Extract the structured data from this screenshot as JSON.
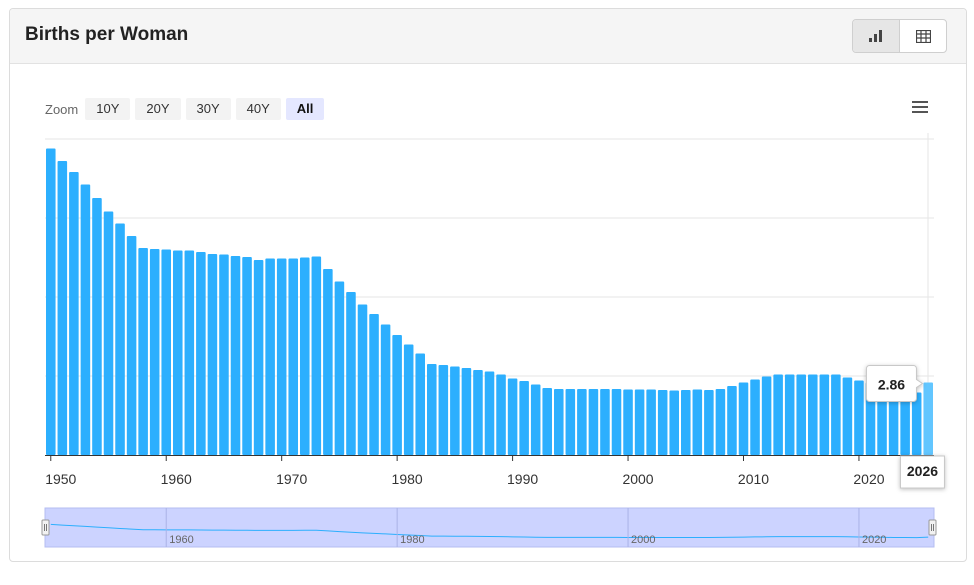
{
  "card": {
    "title": "Births per Woman",
    "toggle": [
      {
        "name": "chart-view-button",
        "icon": "bar-chart-icon",
        "active": true
      },
      {
        "name": "table-view-button",
        "icon": "table-icon",
        "active": false
      }
    ]
  },
  "zoom": {
    "label": "Zoom",
    "buttons": [
      "10Y",
      "20Y",
      "30Y",
      "40Y",
      "All"
    ],
    "active": "All"
  },
  "menu": {
    "icon": "hamburger-menu-icon"
  },
  "colors": {
    "bar": "#2caffe",
    "bar_highlight": "#62c6ff",
    "navigator_fill": "#ccd3ff",
    "navigator_line": "#2caffe"
  },
  "chart_data": {
    "type": "bar",
    "title": "",
    "xlabel": "",
    "ylabel": "",
    "x": [
      1950,
      1951,
      1952,
      1953,
      1954,
      1955,
      1956,
      1957,
      1958,
      1959,
      1960,
      1961,
      1962,
      1963,
      1964,
      1965,
      1966,
      1967,
      1968,
      1969,
      1970,
      1971,
      1972,
      1973,
      1974,
      1975,
      1976,
      1977,
      1978,
      1979,
      1980,
      1981,
      1982,
      1983,
      1984,
      1985,
      1986,
      1987,
      1988,
      1989,
      1990,
      1991,
      1992,
      1993,
      1994,
      1995,
      1996,
      1997,
      1998,
      1999,
      2000,
      2001,
      2002,
      2003,
      2004,
      2005,
      2006,
      2007,
      2008,
      2009,
      2010,
      2011,
      2012,
      2013,
      2014,
      2015,
      2016,
      2017,
      2018,
      2019,
      2020,
      2021,
      2022,
      2023,
      2024,
      2025,
      2026
    ],
    "values": [
      6.13,
      5.88,
      5.66,
      5.41,
      5.14,
      4.87,
      4.63,
      4.38,
      4.14,
      4.12,
      4.11,
      4.09,
      4.09,
      4.06,
      4.02,
      4.01,
      3.98,
      3.96,
      3.9,
      3.93,
      3.93,
      3.93,
      3.95,
      3.97,
      3.72,
      3.47,
      3.26,
      3.01,
      2.82,
      2.61,
      2.4,
      2.21,
      2.03,
      1.82,
      1.8,
      1.77,
      1.74,
      1.7,
      1.67,
      1.61,
      1.53,
      1.48,
      1.41,
      1.34,
      1.32,
      1.32,
      1.32,
      1.32,
      1.32,
      1.32,
      1.31,
      1.31,
      1.31,
      1.3,
      1.29,
      1.3,
      1.31,
      1.3,
      1.32,
      1.38,
      1.45,
      1.51,
      1.57,
      1.61,
      1.61,
      1.61,
      1.61,
      1.61,
      1.61,
      1.55,
      1.49,
      1.45,
      1.35,
      1.31,
      1.29,
      1.25,
      1.45
    ],
    "x_ticks": [
      1950,
      1960,
      1970,
      1980,
      1990,
      2000,
      2010,
      2020
    ],
    "ylim": [
      0,
      6.3
    ],
    "grid": true,
    "highlight": {
      "x": 2026,
      "label": "2.86",
      "year_label": "2026"
    },
    "navigator_ticks": [
      1960,
      1980,
      2000,
      2020
    ]
  }
}
